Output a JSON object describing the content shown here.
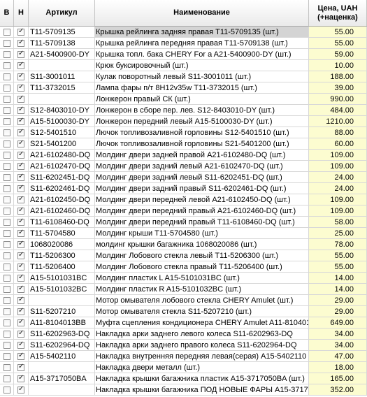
{
  "columns": {
    "b": "В",
    "h": "Н",
    "article": "Артикул",
    "name": "Наименование",
    "price_line1": "Цена, UAH",
    "price_line2": "(+наценка)"
  },
  "rows": [
    {
      "article": "T11-5709135",
      "name": "Крышка рейлинга задняя правая T11-5709135 (шт.)",
      "price": "55.00",
      "b": false,
      "h": true,
      "selected": true
    },
    {
      "article": "T11-5709138",
      "name": "Крышка рейлинга передняя правая T11-5709138 (шт.)",
      "price": "55.00",
      "b": false,
      "h": true
    },
    {
      "article": "A21-5400900-DY",
      "name": "Крышка топл. бака CHERY For a  A21-5400900-DY (шт.)",
      "price": "59.00",
      "b": false,
      "h": true
    },
    {
      "article": "",
      "name": "Крюк буксировочный (шт.)",
      "price": "10.00",
      "b": false,
      "h": true
    },
    {
      "article": "S11-3001011",
      "name": "Кулак поворотный левый S11-3001011 (шт.)",
      "price": "188.00",
      "b": false,
      "h": true
    },
    {
      "article": "T11-3732015",
      "name": "Лампа фары п/т 8Н12v35w T11-3732015 (шт.)",
      "price": "39.00",
      "b": false,
      "h": true
    },
    {
      "article": "",
      "name": "Лонжерон правый СК (шт.)",
      "price": "990.00",
      "b": false,
      "h": true
    },
    {
      "article": "S12-8403010-DY",
      "name": "Лонжерон в сборе пер. лев.  S12-8403010-DY (шт.)",
      "price": "484.00",
      "b": false,
      "h": true
    },
    {
      "article": "A15-5100030-DY",
      "name": "Лонжерон передний левый A15-5100030-DY (шт.)",
      "price": "1210.00",
      "b": false,
      "h": true
    },
    {
      "article": "S12-5401510",
      "name": "Лючок топливозаливной горловины  S12-5401510 (шт.)",
      "price": "88.00",
      "b": false,
      "h": true
    },
    {
      "article": "S21-5401200",
      "name": "Лючок топливозаливной горловины  S21-5401200 (шт.)",
      "price": "60.00",
      "b": false,
      "h": true
    },
    {
      "article": "A21-6102480-DQ",
      "name": "Молдинг двери задней правой   A21-6102480-DQ (шт.)",
      "price": "109.00",
      "b": false,
      "h": true
    },
    {
      "article": "A21-6102470-DQ",
      "name": "Молдинг двери задний левый    A21-6102470-DQ (шт.)",
      "price": "109.00",
      "b": false,
      "h": true
    },
    {
      "article": "S11-6202451-DQ",
      "name": "Молдинг двери задний левый     S11-6202451-DQ (шт.)",
      "price": "24.00",
      "b": false,
      "h": true
    },
    {
      "article": "S11-6202461-DQ",
      "name": "Молдинг двери задний правый     S11-6202461-DQ (шт.)",
      "price": "24.00",
      "b": false,
      "h": true
    },
    {
      "article": "A21-6102450-DQ",
      "name": "Молдинг двери передней левой    A21-6102450-DQ (шт.)",
      "price": "109.00",
      "b": false,
      "h": true
    },
    {
      "article": "A21-6102460-DQ",
      "name": "Молдинг двери передний правый    A21-6102460-DQ (шт.)",
      "price": "109.00",
      "b": false,
      "h": true
    },
    {
      "article": "T11-6108460-DQ",
      "name": "Молдинг двери передний правый T11-6108460-DQ (шт.)",
      "price": "58.00",
      "b": false,
      "h": true
    },
    {
      "article": "T11-5704580",
      "name": "Молдинг крыши T11-5704580 (шт.)",
      "price": "25.00",
      "b": false,
      "h": true
    },
    {
      "article": "1068020086",
      "name": "молдинг крышки багажника 1068020086 (шт.)",
      "price": "78.00",
      "b": false,
      "h": true
    },
    {
      "article": "T11-5206300",
      "name": "Молдинг Лобового стекла левый T11-5206300 (шт.)",
      "price": "55.00",
      "b": false,
      "h": true
    },
    {
      "article": "T11-5206400",
      "name": "Молдинг Лобового стекла правый T11-5206400 (шт.)",
      "price": "55.00",
      "b": false,
      "h": true
    },
    {
      "article": "A15-5101031BC",
      "name": "Молдинг пластик  L A15-5101031BC (шт.)",
      "price": "14.00",
      "b": false,
      "h": true
    },
    {
      "article": "A15-5101032BC",
      "name": "Молдинг пластик R A15-5101032BC (шт.)",
      "price": "14.00",
      "b": false,
      "h": true
    },
    {
      "article": "",
      "name": "Мотор омывателя лобового стекла CHERY Amulet (шт.)",
      "price": "29.00",
      "b": false,
      "h": true
    },
    {
      "article": "S11-5207210",
      "name": "Мотор омывателя стекла    S11-5207210 (шт.)",
      "price": "29.00",
      "b": false,
      "h": true
    },
    {
      "article": "A11-8104013BB",
      "name": "Муфта сцепления кондиционера CHERY Amulet A11-810401",
      "price": "649.00",
      "b": false,
      "h": true
    },
    {
      "article": "S11-6202963-DQ",
      "name": "Накладка арки заднего левого колеса     S11-6202963-DQ",
      "price": "34.00",
      "b": false,
      "h": true
    },
    {
      "article": "S11-6202964-DQ",
      "name": "Накладка арки заднего правого колеса     S11-6202964-DQ",
      "price": "34.00",
      "b": false,
      "h": true
    },
    {
      "article": "A15-5402110",
      "name": "Накладка внутренняя передняя левая(серая) A15-5402110",
      "price": "47.00",
      "b": false,
      "h": true
    },
    {
      "article": "",
      "name": "Накладка двери металл (шт.)",
      "price": "18.00",
      "b": false,
      "h": true
    },
    {
      "article": "A15-3717050BA",
      "name": "Накладка крышки багажника пластик A15-3717050BA (шт.)",
      "price": "165.00",
      "b": false,
      "h": true
    },
    {
      "article": "",
      "name": "Накладка крышки багажника ПОД НОВЫЕ ФАРЫ A15-37170",
      "price": "352.00",
      "b": false,
      "h": true
    }
  ]
}
